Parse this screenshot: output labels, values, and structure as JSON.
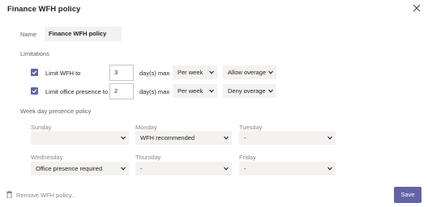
{
  "dialog": {
    "title": "Finance WFH policy",
    "close_icon": "close-icon"
  },
  "name_field": {
    "label": "Name",
    "value": "Finance WFH policy"
  },
  "limitations": {
    "heading": "Limitations",
    "rows": [
      {
        "checked": true,
        "label": "Limit WFH to",
        "value": "3",
        "unit": "day(s) max",
        "period": "Per week",
        "overage": "Allow overage"
      },
      {
        "checked": true,
        "label": "Limit office presence to",
        "value": "2",
        "unit": "day(s) max",
        "period": "Per week",
        "overage": "Deny overage"
      }
    ]
  },
  "week_policy": {
    "heading": "Week day presence policy",
    "days": [
      {
        "day": "Sunday",
        "value": ""
      },
      {
        "day": "Monday",
        "value": "WFH recommended"
      },
      {
        "day": "Tuesday",
        "value": "-"
      },
      {
        "day": "Wednesday",
        "value": "Office presence required"
      },
      {
        "day": "Thursday",
        "value": "-"
      },
      {
        "day": "Friday",
        "value": "-"
      }
    ]
  },
  "footer": {
    "remove_label": "Remove WFH policy...",
    "save_label": "Save"
  },
  "colors": {
    "accent": "#6264a7",
    "field_bg": "#f3f2f1"
  }
}
